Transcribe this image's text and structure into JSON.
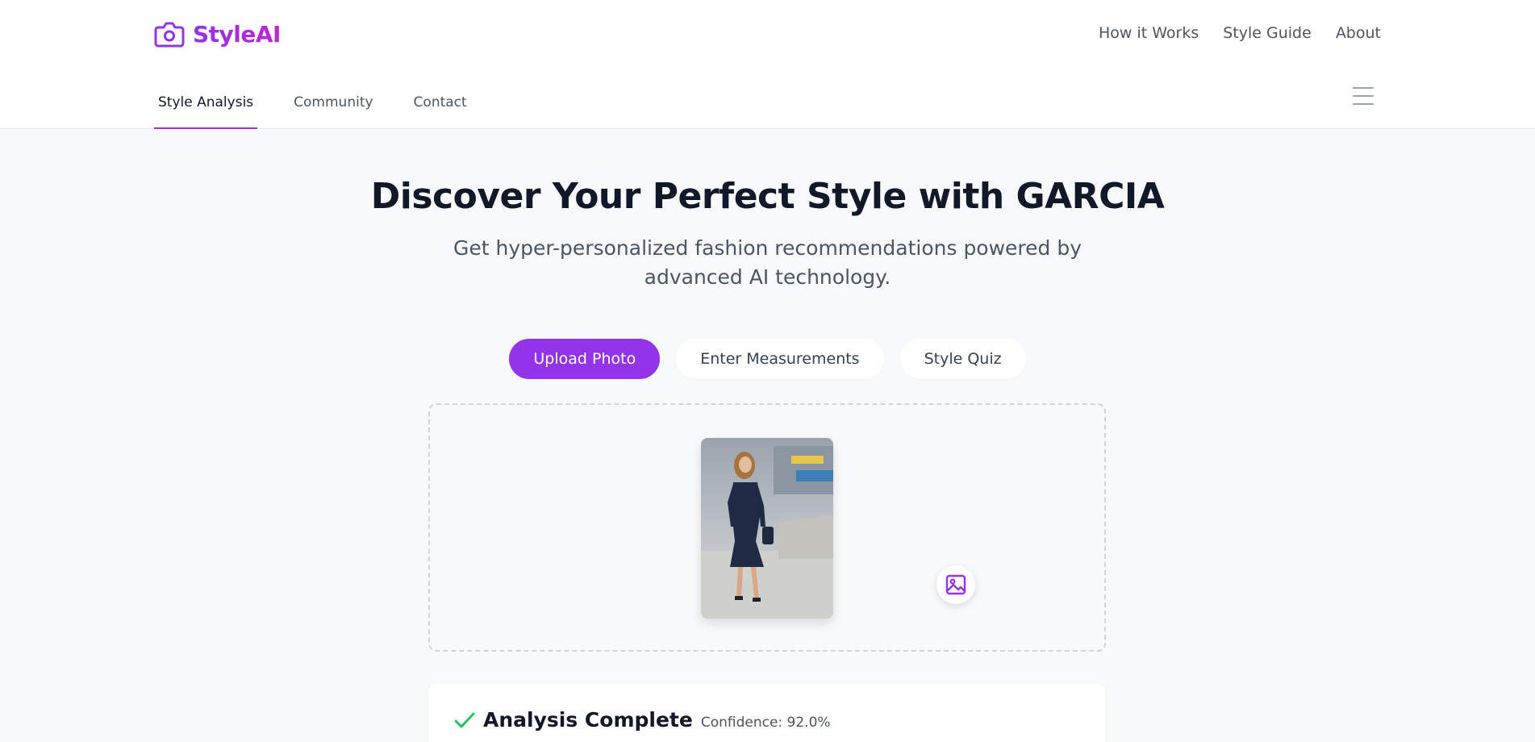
{
  "brand": {
    "name": "StyleAI",
    "accent": "#9333ea",
    "accent_alt": "#c026d3",
    "icon": "camera-icon"
  },
  "top_nav": {
    "how_it_works": "How it Works",
    "style_guide": "Style Guide",
    "about": "About"
  },
  "nav_tabs": {
    "style_analysis": "Style Analysis",
    "community": "Community",
    "contact": "Contact",
    "active": "Style Analysis"
  },
  "hero": {
    "title": "Discover Your Perfect Style with GARCIA",
    "subtitle": "Get hyper-personalized fashion recommendations powered by advanced AI technology."
  },
  "modes": {
    "upload_photo": "Upload Photo",
    "enter_measurements": "Enter Measurements",
    "style_quiz": "Style Quiz",
    "active": "Upload Photo"
  },
  "upload": {
    "preview_image": "uploaded-photo-preview",
    "image_button_icon": "image-icon"
  },
  "analysis": {
    "title": "Analysis Complete",
    "confidence": "Confidence: 92.0%",
    "status_icon": "check-icon",
    "status_color": "#22c55e"
  }
}
